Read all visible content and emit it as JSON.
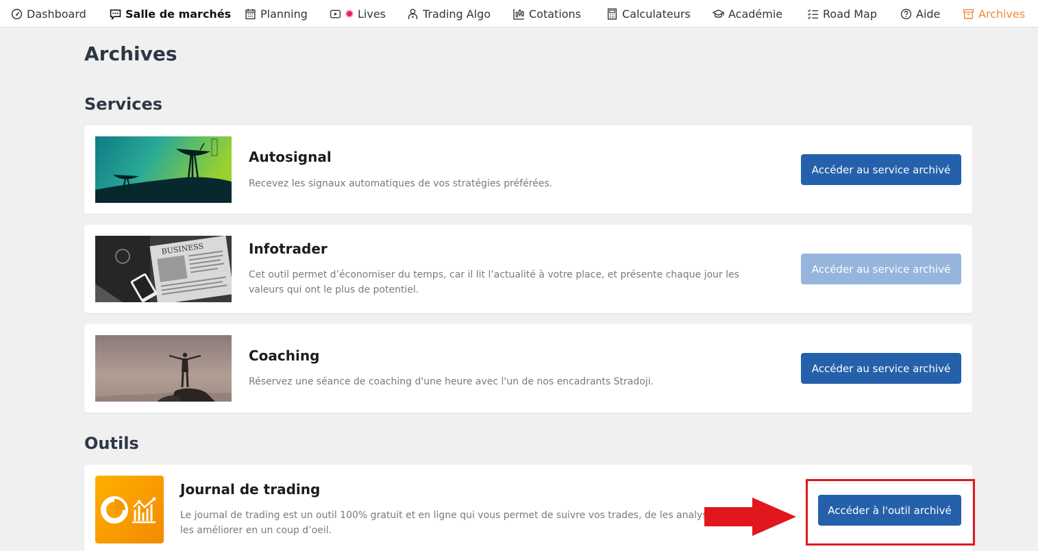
{
  "nav": {
    "items": [
      {
        "label": "Dashboard",
        "icon": "gauge-icon"
      },
      {
        "label": "Salle de marchés",
        "icon": "chat-icon"
      },
      {
        "label": "Planning",
        "icon": "calendar-icon"
      },
      {
        "label": "Lives",
        "icon": "youtube-icon"
      },
      {
        "label": "Trading Algo",
        "icon": "robot-icon"
      },
      {
        "label": "Cotations",
        "icon": "candlestick-icon"
      },
      {
        "label": "Calculateurs",
        "icon": "calculator-icon"
      },
      {
        "label": "Académie",
        "icon": "graduation-cap-icon"
      },
      {
        "label": "Road Map",
        "icon": "checklist-icon"
      },
      {
        "label": "Aide",
        "icon": "help-circle-icon"
      },
      {
        "label": "Archives",
        "icon": "archive-icon"
      }
    ],
    "active": "Archives"
  },
  "page": {
    "title": "Archives"
  },
  "sections": {
    "services": {
      "title": "Services",
      "cards": [
        {
          "title": "Autosignal",
          "description_lines": [
            "Recevez les signaux automatiques de vos stratégies préférées."
          ],
          "button": "Accéder au service archivé",
          "button_enabled": true
        },
        {
          "title": "Infotrader",
          "description_lines": [
            "Cet outil permet d’économiser du temps, car il lit l’actualité à votre place, et présente chaque jour les",
            "valeurs qui ont le plus de potentiel."
          ],
          "image_text": "BUSINESS",
          "button": "Accéder au service archivé",
          "button_enabled": false
        },
        {
          "title": "Coaching",
          "description_lines": [
            "Réservez une séance de coaching d'une heure avec l'un de nos encadrants Stradoji."
          ],
          "button": "Accéder au service archivé",
          "button_enabled": true
        }
      ]
    },
    "outils": {
      "title": "Outils",
      "cards": [
        {
          "title": "Journal de trading",
          "description_lines": [
            "Le journal de trading est un outil 100% gratuit et en ligne qui vous permet de suivre vos trades, de les analyser",
            "les améliorer en un coup d’oeil."
          ],
          "button": "Accéder à l'outil archivé",
          "button_enabled": true
        }
      ]
    }
  },
  "colors": {
    "primary_button": "#2560ab",
    "disabled_button": "#96b5dc",
    "active_nav": "#f0883e",
    "highlight": "#e2161e"
  }
}
